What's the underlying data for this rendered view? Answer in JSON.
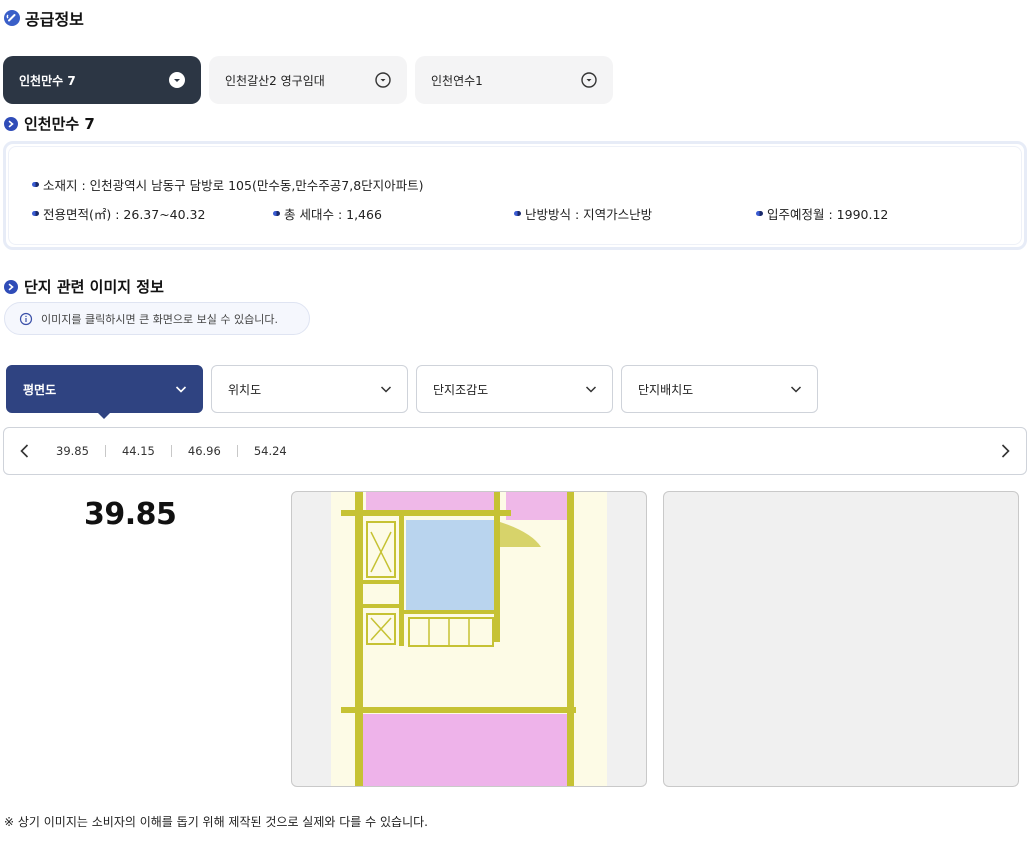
{
  "header": {
    "title": "공급정보"
  },
  "tabs": [
    {
      "label": "인천만수 7",
      "active": true
    },
    {
      "label": "인천갈산2 영구임대",
      "active": false
    },
    {
      "label": "인천연수1",
      "active": false
    }
  ],
  "complex": {
    "title": "인천만수 7",
    "address": "소재지 : 인천광역시 남동구 담방로 105(만수동,만수주공7,8단지아파트)",
    "area": "전용면적(㎡) : 26.37~40.32",
    "households": "총 세대수 : 1,466",
    "heating": "난방방식 : 지역가스난방",
    "move_in": "입주예정월 : 1990.12"
  },
  "images": {
    "title": "단지 관련 이미지 정보",
    "notice": "이미지를 클릭하시면 큰 화면으로 보실 수 있습니다.",
    "dropdowns": [
      {
        "label": "평면도",
        "active": true
      },
      {
        "label": "위치도",
        "active": false
      },
      {
        "label": "단지조감도",
        "active": false
      },
      {
        "label": "단지배치도",
        "active": false
      }
    ],
    "sizes": [
      "39.85",
      "44.15",
      "46.96",
      "54.24"
    ],
    "selected_size": "39.85"
  },
  "footnote": "※ 상기 이미지는 소비자의 이해를 돕기 위해 제작된 것으로 실제와 다를 수 있습니다.",
  "colors": {
    "accent_dark": "#2c3644",
    "accent_blue": "#2f4381"
  }
}
